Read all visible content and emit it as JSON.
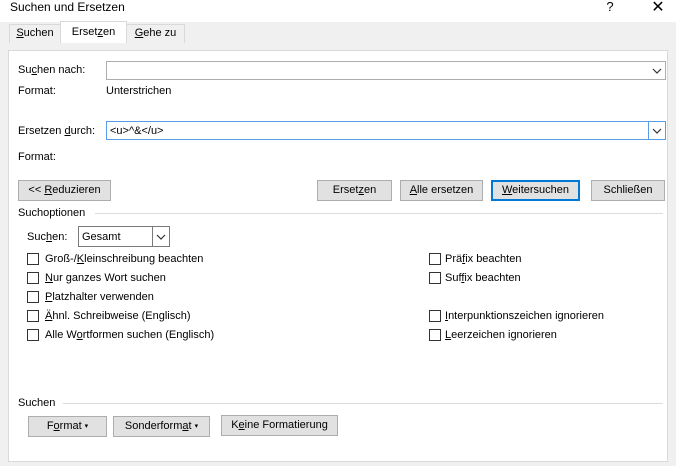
{
  "window": {
    "title": "Suchen und Ersetzen",
    "help_glyph": "?",
    "close_glyph": "✕"
  },
  "tabs": [
    {
      "label_pre": "",
      "label_key": "S",
      "label_post": "uchen"
    },
    {
      "label_pre": "Erset",
      "label_key": "z",
      "label_post": "en"
    },
    {
      "label_pre": "",
      "label_key": "G",
      "label_post": "ehe zu"
    }
  ],
  "find": {
    "label_pre": "Su",
    "label_key": "c",
    "label_post": "hen nach:",
    "value": "",
    "format_label": "Format:",
    "format_value": "Unterstrichen"
  },
  "replace": {
    "label_pre": "Ersetzen ",
    "label_key": "d",
    "label_post": "urch:",
    "value": "<u>^&</u>",
    "format_label": "Format:",
    "format_value": ""
  },
  "buttons": {
    "reduce": {
      "pre": "<< ",
      "key": "R",
      "post": "eduzieren"
    },
    "replace": {
      "pre": "Erset",
      "key": "z",
      "post": "en"
    },
    "replace_all": {
      "pre": "",
      "key": "A",
      "post": "lle ersetzen"
    },
    "find_next": {
      "pre": "",
      "key": "W",
      "post": "eitersuchen"
    },
    "close": "Schließen"
  },
  "search_options": {
    "heading": "Suchoptionen",
    "search_label_pre": "Suc",
    "search_label_key": "h",
    "search_label_post": "en:",
    "search_direction": "Gesamt"
  },
  "checkboxes_left": [
    {
      "pre": "Groß-/",
      "key": "K",
      "post": "leinschreibung beachten",
      "checked": false
    },
    {
      "pre": "",
      "key": "N",
      "post": "ur ganzes Wort suchen",
      "checked": false
    },
    {
      "pre": "",
      "key": "P",
      "post": "latzhalter verwenden",
      "checked": false
    },
    {
      "pre": "",
      "key": "Ä",
      "post": "hnl. Schreibweise (Englisch)",
      "checked": false
    },
    {
      "pre": "Alle W",
      "key": "o",
      "post": "rtformen suchen (Englisch)",
      "checked": false
    }
  ],
  "checkboxes_right": [
    {
      "pre": "Prä",
      "key": "f",
      "post": "ix beachten",
      "checked": false
    },
    {
      "pre": "Suf",
      "key": "f",
      "post": "ix beachten",
      "checked": false
    },
    {
      "pre": "",
      "key": "I",
      "post": "nterpunktionszeichen ignorieren",
      "checked": false
    },
    {
      "pre": "",
      "key": "L",
      "post": "eerzeichen ignorieren",
      "checked": false
    }
  ],
  "bottom": {
    "heading": "Suchen",
    "format_btn": {
      "pre": "F",
      "key": "o",
      "post": "rmat"
    },
    "special_btn": {
      "pre": "Sonderform",
      "key": "a",
      "post": "t"
    },
    "no_format_btn": {
      "pre": "K",
      "key": "e",
      "post": "ine Formatierung"
    },
    "caret": "▾"
  }
}
